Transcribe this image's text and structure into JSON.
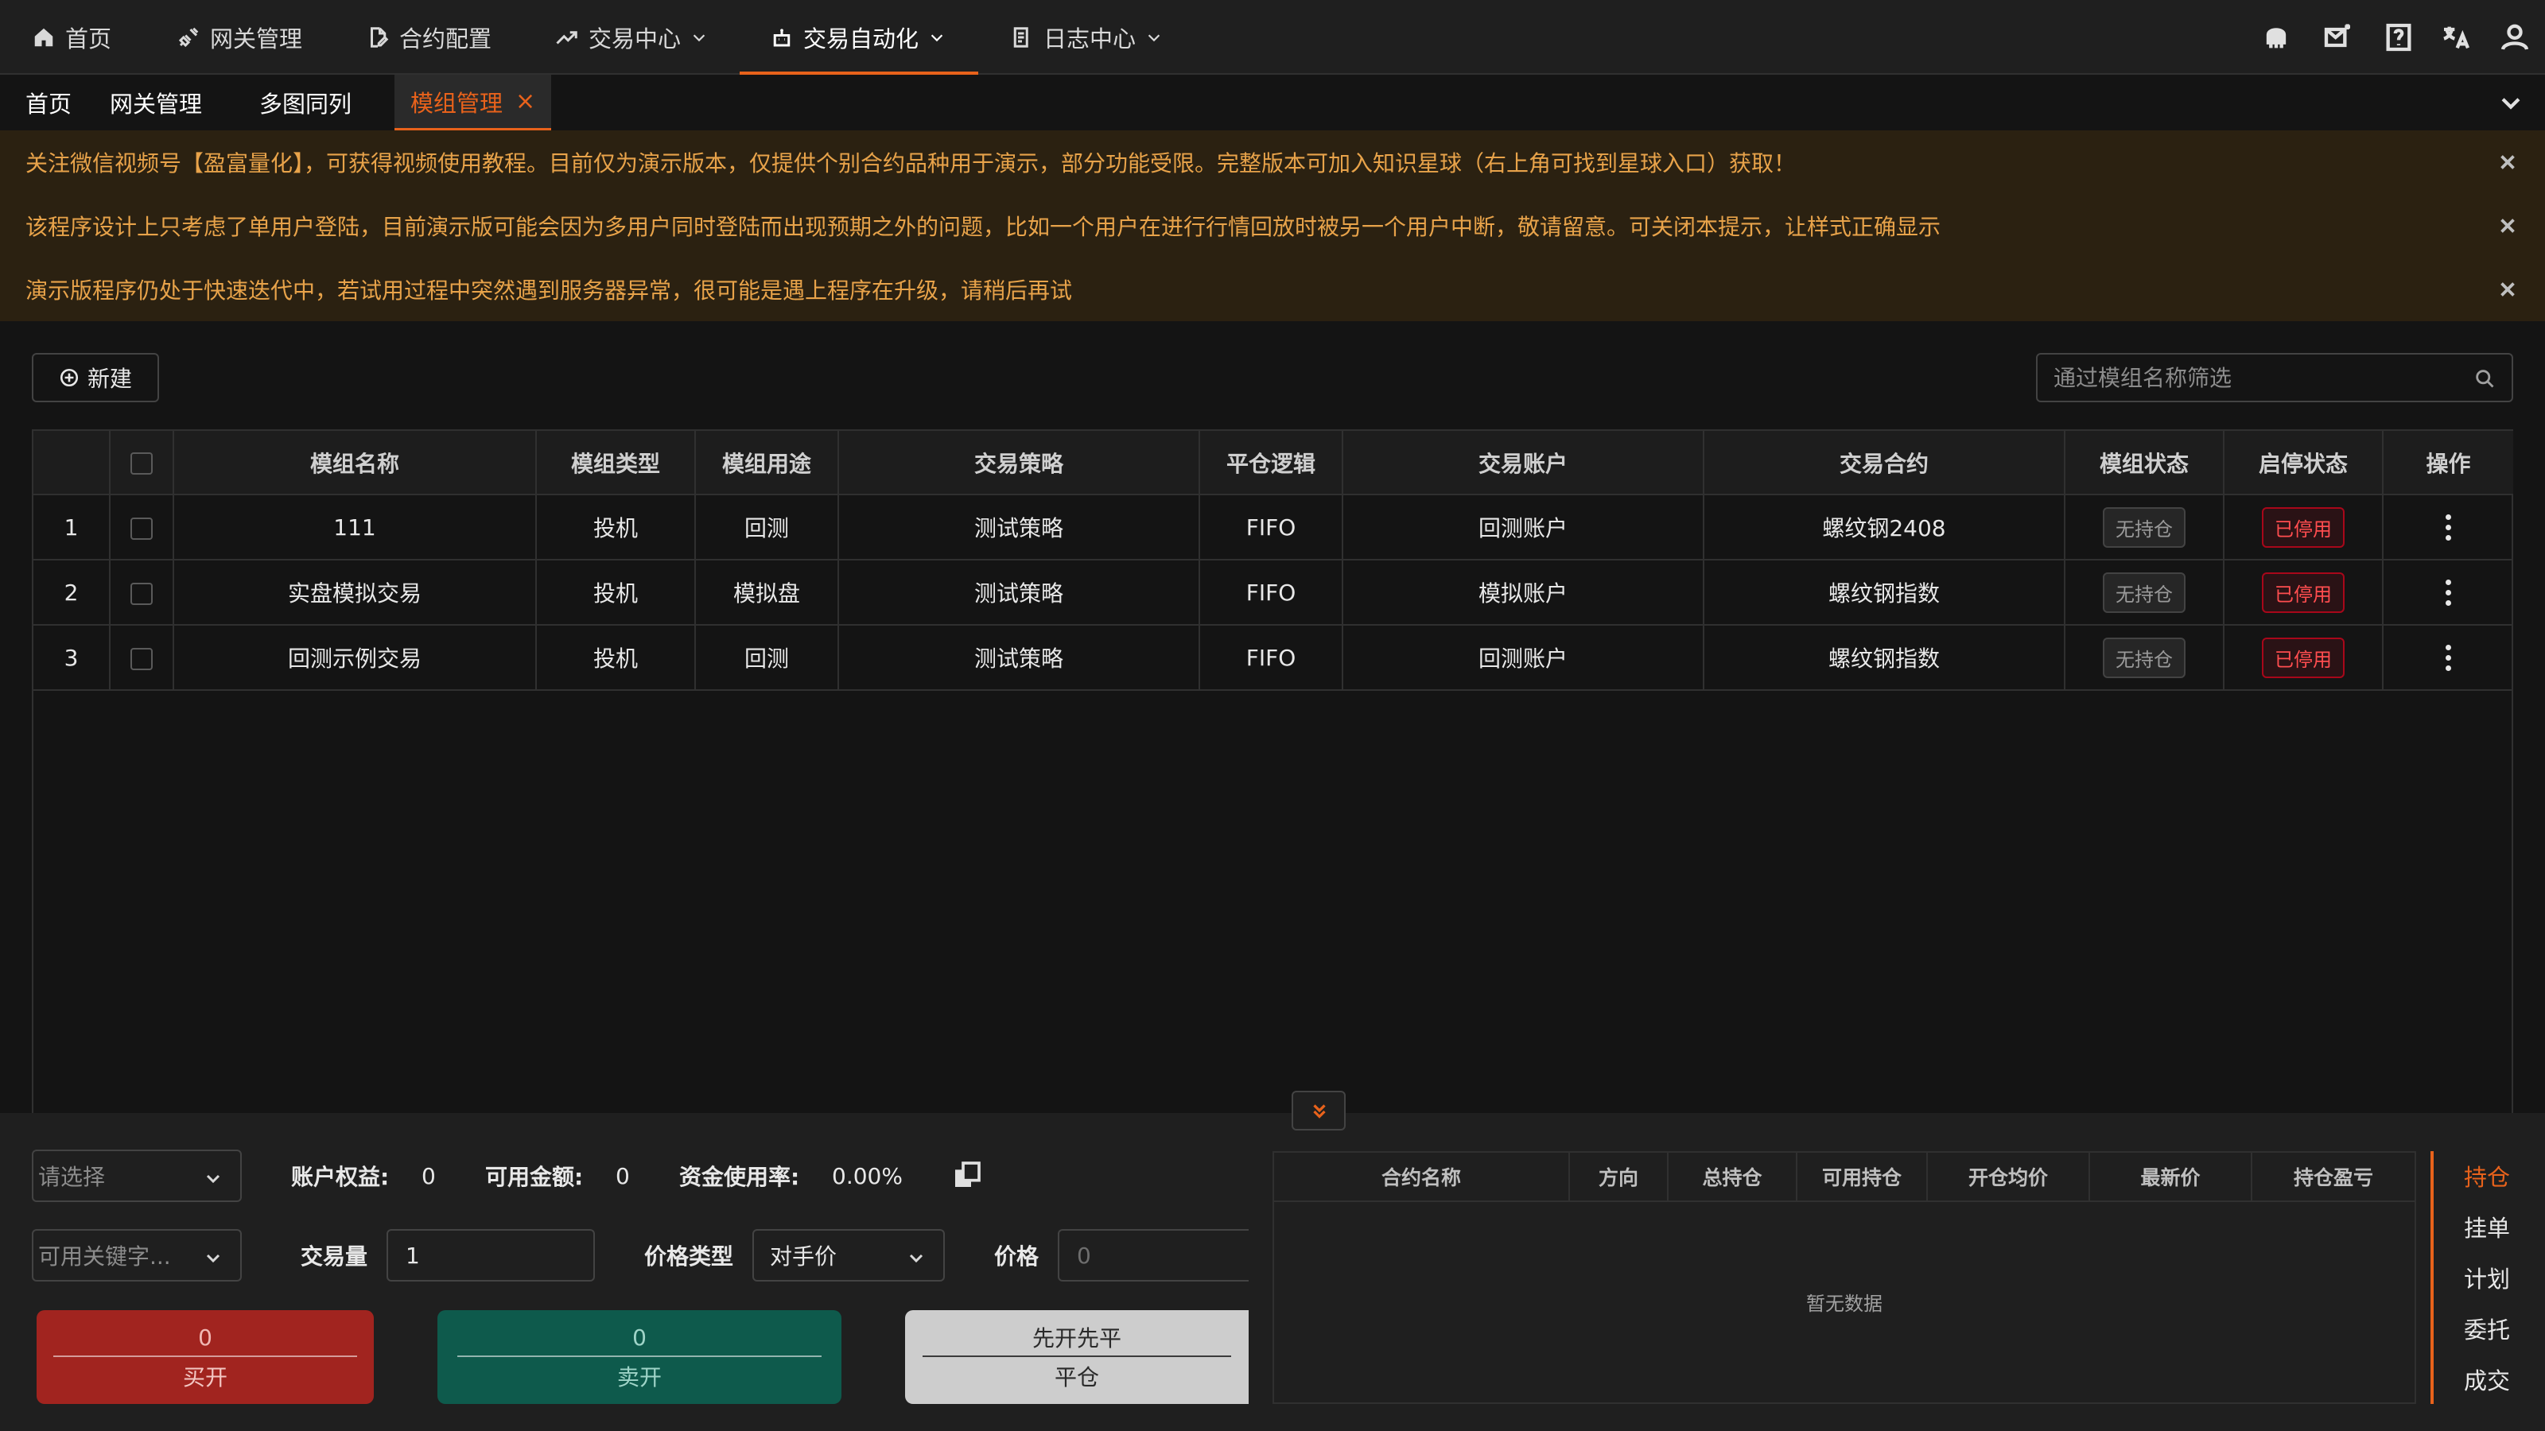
{
  "nav": {
    "items": [
      {
        "label": "首页"
      },
      {
        "label": "网关管理"
      },
      {
        "label": "合约配置"
      },
      {
        "label": "交易中心"
      },
      {
        "label": "交易自动化"
      },
      {
        "label": "日志中心"
      }
    ],
    "right_icons": [
      "robot-icon",
      "mail-icon",
      "help-icon",
      "translate-icon",
      "user-icon"
    ]
  },
  "tabs": [
    {
      "label": "首页"
    },
    {
      "label": "网关管理"
    },
    {
      "label": "多图同列"
    },
    {
      "label": "模组管理",
      "active": true
    }
  ],
  "alerts": [
    "关注微信视频号【盈富量化】，可获得视频使用教程。目前仅为演示版本，仅提供个别合约品种用于演示，部分功能受限。完整版本可加入知识星球（右上角可找到星球入口）获取！",
    "该程序设计上只考虑了单用户登陆，目前演示版可能会因为多用户同时登陆而出现预期之外的问题，比如一个用户在进行行情回放时被另一个用户中断，敬请留意。可关闭本提示，让样式正确显示",
    "演示版程序仍处于快速迭代中，若试用过程中突然遇到服务器异常，很可能是遇上程序在升级，请稍后再试"
  ],
  "toolbar": {
    "new_label": "新建",
    "search_placeholder": "通过模组名称筛选"
  },
  "table": {
    "headers": [
      "模组名称",
      "模组类型",
      "模组用途",
      "交易策略",
      "平仓逻辑",
      "交易账户",
      "交易合约",
      "模组状态",
      "启停状态",
      "操作"
    ],
    "rows": [
      {
        "idx": "1",
        "name": "111",
        "type": "投机",
        "usage": "回测",
        "strategy": "测试策略",
        "logic": "FIFO",
        "account": "回测账户",
        "contract": "螺纹钢2408",
        "status": "无持仓",
        "switch": "已停用"
      },
      {
        "idx": "2",
        "name": "实盘模拟交易",
        "type": "投机",
        "usage": "模拟盘",
        "strategy": "测试策略",
        "logic": "FIFO",
        "account": "模拟账户",
        "contract": "螺纹钢指数",
        "status": "无持仓",
        "switch": "已停用"
      },
      {
        "idx": "3",
        "name": "回测示例交易",
        "type": "投机",
        "usage": "回测",
        "strategy": "测试策略",
        "logic": "FIFO",
        "account": "回测账户",
        "contract": "螺纹钢指数",
        "status": "无持仓",
        "switch": "已停用"
      }
    ]
  },
  "trade": {
    "account_select_placeholder": "请选择",
    "equity_label": "账户权益:",
    "equity_value": "0",
    "available_label": "可用金额:",
    "available_value": "0",
    "usage_label": "资金使用率:",
    "usage_value": "0.00%",
    "keyword_select_placeholder": "可用关键字...",
    "volume_label": "交易量",
    "volume_value": "1",
    "price_type_label": "价格类型",
    "price_type_value": "对手价",
    "price_label": "价格",
    "price_placeholder": "0",
    "buy_price": "0",
    "buy_label": "买开",
    "sell_price": "0",
    "sell_label": "卖开",
    "close_mode": "先开先平",
    "close_label": "平仓"
  },
  "positions": {
    "headers": [
      "合约名称",
      "方向",
      "总持仓",
      "可用持仓",
      "开仓均价",
      "最新价",
      "持仓盈亏"
    ],
    "empty_text": "暂无数据"
  },
  "side_tabs": [
    {
      "label": "持仓",
      "active": true
    },
    {
      "label": "挂单"
    },
    {
      "label": "计划"
    },
    {
      "label": "委托"
    },
    {
      "label": "成交"
    }
  ],
  "colors": {
    "accent": "#e8621b",
    "alert_bg": "#2b2111",
    "alert_text": "#e8a34a",
    "buy": "#a1241f",
    "sell": "#0e5a4c",
    "danger": "#ff4d4f"
  }
}
